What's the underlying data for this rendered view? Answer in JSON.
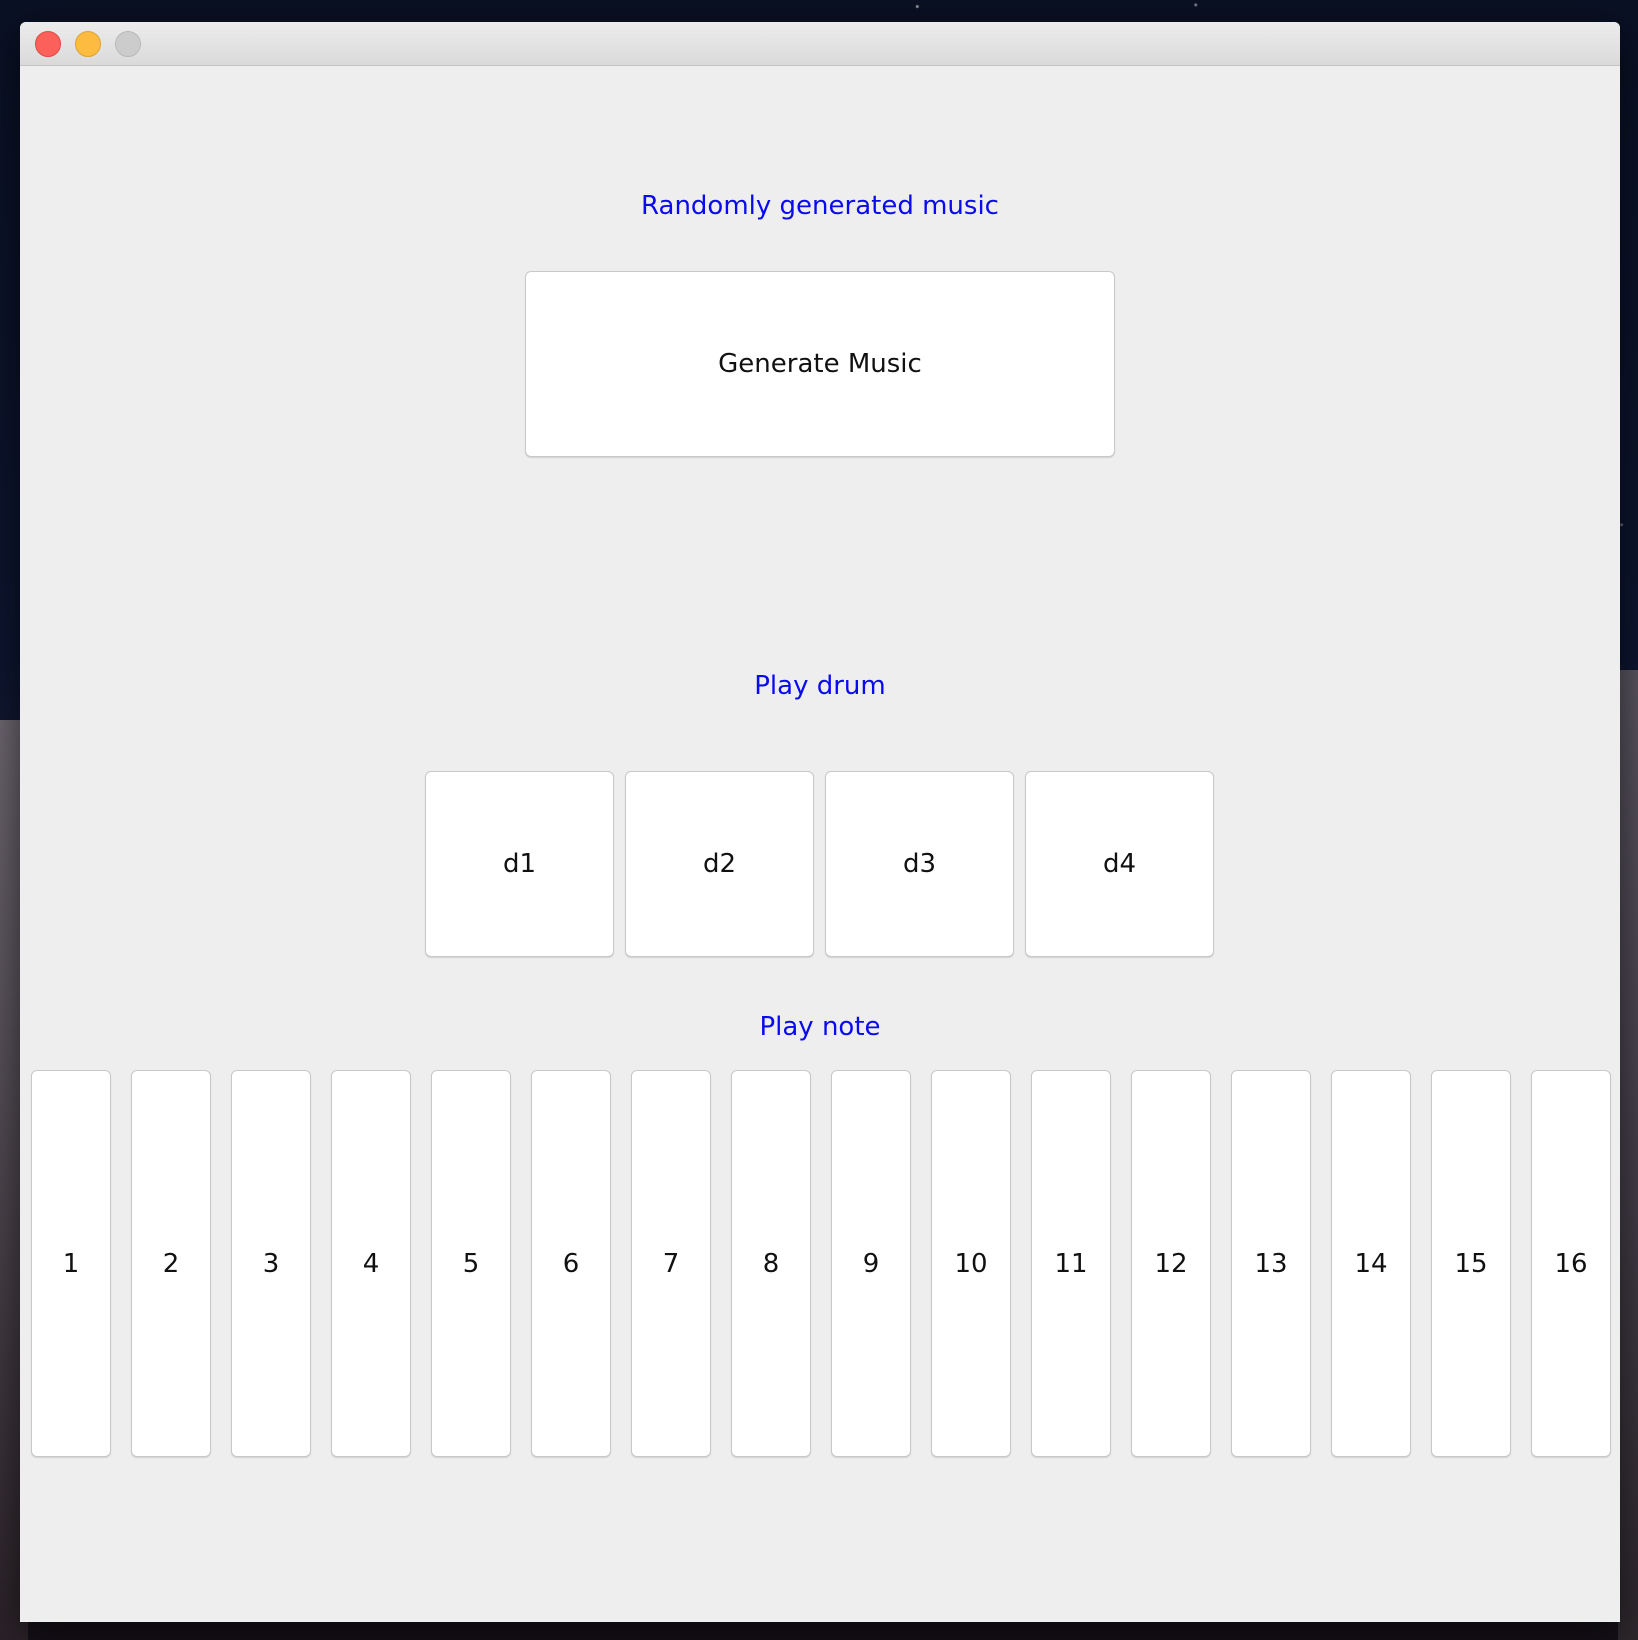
{
  "window": {
    "controls": [
      "close",
      "minimize",
      "zoom"
    ]
  },
  "sections": {
    "random_music": {
      "label": "Randomly generated music",
      "button": "Generate Music"
    },
    "drum": {
      "label": "Play drum",
      "buttons": [
        "d1",
        "d2",
        "d3",
        "d4"
      ]
    },
    "note": {
      "label": "Play note",
      "buttons": [
        "1",
        "2",
        "3",
        "4",
        "5",
        "6",
        "7",
        "8",
        "9",
        "10",
        "11",
        "12",
        "13",
        "14",
        "15",
        "16"
      ]
    }
  },
  "colors": {
    "label": "#0a0aee",
    "window_bg": "#eeeeee",
    "button_bg": "#ffffff"
  }
}
